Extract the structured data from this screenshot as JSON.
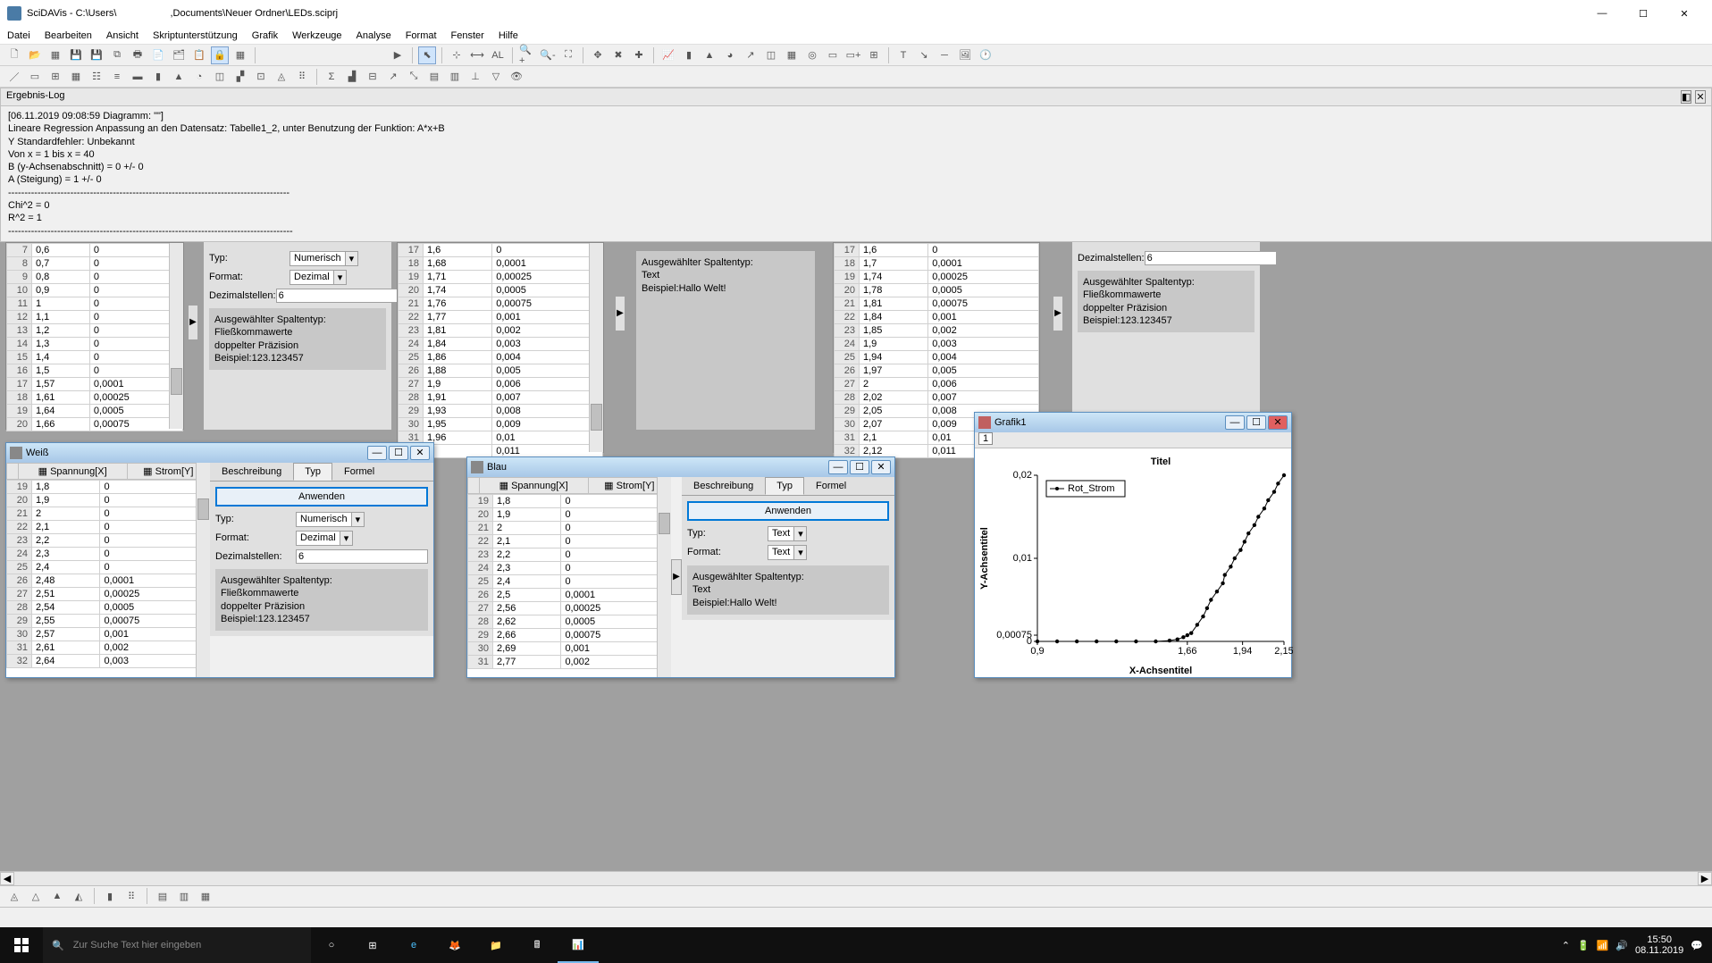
{
  "title_app": "SciDAVis - C:\\Users\\",
  "title_path": ",Documents\\Neuer Ordner\\LEDs.sciprj",
  "menu": [
    "Datei",
    "Bearbeiten",
    "Ansicht",
    "Skriptunterstützung",
    "Grafik",
    "Werkzeuge",
    "Analyse",
    "Format",
    "Fenster",
    "Hilfe"
  ],
  "log": {
    "title": "Ergebnis-Log",
    "lines": [
      "[06.11.2019 09:08:59        Diagramm: \"\"]",
      "Lineare Regression Anpassung an den Datensatz: Tabelle1_2, unter Benutzung der Funktion: A*x+B",
      "Y Standardfehler: Unbekannt",
      "Von x = 1 bis x = 40",
      "B (y-Achsenabschnitt) = 0 +/- 0",
      "A (Steigung) = 1 +/- 0",
      "--------------------------------------------------------------------------------------",
      "Chi^2 = 0",
      "R^2 = 1",
      "---------------------------------------------------------------------------------------"
    ]
  },
  "panel1": {
    "typ_label": "Typ:",
    "typ_val": "Numerisch",
    "format_label": "Format:",
    "format_val": "Dezimal",
    "dec_label": "Dezimalstellen:",
    "dec_val": "6",
    "info_title": "Ausgewählter Spaltentyp:",
    "info_l1": "Fließkommawerte",
    "info_l2": "doppelter Präzision",
    "info_l3": "Beispiel:123.123457"
  },
  "panel_text": {
    "info_title": "Ausgewählter Spaltentyp:",
    "info_l1": "Text",
    "info_l2": "Beispiel:Hallo Welt!"
  },
  "table_bg1": {
    "rows": [
      [
        7,
        "0,6",
        "0"
      ],
      [
        8,
        "0,7",
        "0"
      ],
      [
        9,
        "0,8",
        "0"
      ],
      [
        10,
        "0,9",
        "0"
      ],
      [
        11,
        "1",
        "0"
      ],
      [
        12,
        "1,1",
        "0"
      ],
      [
        13,
        "1,2",
        "0"
      ],
      [
        14,
        "1,3",
        "0"
      ],
      [
        15,
        "1,4",
        "0"
      ],
      [
        16,
        "1,5",
        "0"
      ],
      [
        17,
        "1,57",
        "0,0001"
      ],
      [
        18,
        "1,61",
        "0,00025"
      ],
      [
        19,
        "1,64",
        "0,0005"
      ],
      [
        20,
        "1,66",
        "0,00075"
      ]
    ]
  },
  "table_bg2": {
    "rows": [
      [
        17,
        "1,6",
        "0"
      ],
      [
        18,
        "1,68",
        "0,0001"
      ],
      [
        19,
        "1,71",
        "0,00025"
      ],
      [
        20,
        "1,74",
        "0,0005"
      ],
      [
        21,
        "1,76",
        "0,00075"
      ],
      [
        22,
        "1,77",
        "0,001"
      ],
      [
        23,
        "1,81",
        "0,002"
      ],
      [
        24,
        "1,84",
        "0,003"
      ],
      [
        25,
        "1,86",
        "0,004"
      ],
      [
        26,
        "1,88",
        "0,005"
      ],
      [
        27,
        "1,9",
        "0,006"
      ],
      [
        28,
        "1,91",
        "0,007"
      ],
      [
        29,
        "1,93",
        "0,008"
      ],
      [
        30,
        "1,95",
        "0,009"
      ],
      [
        31,
        "1,96",
        "0,01"
      ],
      [
        32,
        "",
        "0,011"
      ]
    ]
  },
  "table_bg3": {
    "rows": [
      [
        17,
        "1,6",
        "0"
      ],
      [
        18,
        "1,7",
        "0,0001"
      ],
      [
        19,
        "1,74",
        "0,00025"
      ],
      [
        20,
        "1,78",
        "0,0005"
      ],
      [
        21,
        "1,81",
        "0,00075"
      ],
      [
        22,
        "1,84",
        "0,001"
      ],
      [
        23,
        "1,85",
        "0,002"
      ],
      [
        24,
        "1,9",
        "0,003"
      ],
      [
        25,
        "1,94",
        "0,004"
      ],
      [
        26,
        "1,97",
        "0,005"
      ],
      [
        27,
        "2",
        "0,006"
      ],
      [
        28,
        "2,02",
        "0,007"
      ],
      [
        29,
        "2,05",
        "0,008"
      ],
      [
        30,
        "2,07",
        "0,009"
      ],
      [
        31,
        "2,1",
        "0,01"
      ],
      [
        32,
        "2,12",
        "0,011"
      ]
    ]
  },
  "panel_bg3": {
    "dec_label": "Dezimalstellen:",
    "dec_val": "6"
  },
  "weiss": {
    "title": "Weiß",
    "col1": "Spannung[X]",
    "col2": "Strom[Y]",
    "rows": [
      [
        19,
        "1,8",
        "0"
      ],
      [
        20,
        "1,9",
        "0"
      ],
      [
        21,
        "2",
        "0"
      ],
      [
        22,
        "2,1",
        "0"
      ],
      [
        23,
        "2,2",
        "0"
      ],
      [
        24,
        "2,3",
        "0"
      ],
      [
        25,
        "2,4",
        "0"
      ],
      [
        26,
        "2,48",
        "0,0001"
      ],
      [
        27,
        "2,51",
        "0,00025"
      ],
      [
        28,
        "2,54",
        "0,0005"
      ],
      [
        29,
        "2,55",
        "0,00075"
      ],
      [
        30,
        "2,57",
        "0,001"
      ],
      [
        31,
        "2,61",
        "0,002"
      ],
      [
        32,
        "2,64",
        "0,003"
      ]
    ],
    "tabs": [
      "Beschreibung",
      "Typ",
      "Formel"
    ],
    "apply": "Anwenden"
  },
  "blau": {
    "title": "Blau",
    "col1": "Spannung[X]",
    "col2": "Strom[Y]",
    "rows": [
      [
        19,
        "1,8",
        "0"
      ],
      [
        20,
        "1,9",
        "0"
      ],
      [
        21,
        "2",
        "0"
      ],
      [
        22,
        "2,1",
        "0"
      ],
      [
        23,
        "2,2",
        "0"
      ],
      [
        24,
        "2,3",
        "0"
      ],
      [
        25,
        "2,4",
        "0"
      ],
      [
        26,
        "2,5",
        "0,0001"
      ],
      [
        27,
        "2,56",
        "0,00025"
      ],
      [
        28,
        "2,62",
        "0,0005"
      ],
      [
        29,
        "2,66",
        "0,00075"
      ],
      [
        30,
        "2,69",
        "0,001"
      ],
      [
        31,
        "2,77",
        "0,002"
      ]
    ],
    "tabs": [
      "Beschreibung",
      "Typ",
      "Formel"
    ],
    "apply": "Anwenden",
    "typ_label": "Typ:",
    "typ_val": "Text",
    "format_label": "Format:",
    "format_val": "Text"
  },
  "grafik": {
    "title": "Grafik1",
    "tab": "1"
  },
  "chart_data": {
    "type": "scatter",
    "title": "Titel",
    "xlabel": "X-Achsentitel",
    "ylabel": "Y-Achsentitel",
    "legend": "Rot_Strom",
    "x_ticks": [
      "0,9",
      "1,66",
      "1,94",
      "2,15"
    ],
    "y_ticks": [
      "0",
      "0,00075",
      "0,01",
      "0,02"
    ],
    "series": [
      {
        "name": "Rot_Strom",
        "points": [
          [
            0.9,
            0
          ],
          [
            1.0,
            0
          ],
          [
            1.1,
            0
          ],
          [
            1.2,
            0
          ],
          [
            1.3,
            0
          ],
          [
            1.4,
            0
          ],
          [
            1.5,
            0
          ],
          [
            1.57,
            0.0001
          ],
          [
            1.61,
            0.00025
          ],
          [
            1.64,
            0.0005
          ],
          [
            1.66,
            0.00075
          ],
          [
            1.68,
            0.001
          ],
          [
            1.71,
            0.002
          ],
          [
            1.74,
            0.003
          ],
          [
            1.76,
            0.004
          ],
          [
            1.78,
            0.005
          ],
          [
            1.81,
            0.006
          ],
          [
            1.84,
            0.007
          ],
          [
            1.85,
            0.008
          ],
          [
            1.88,
            0.009
          ],
          [
            1.9,
            0.01
          ],
          [
            1.93,
            0.011
          ],
          [
            1.95,
            0.012
          ],
          [
            1.97,
            0.013
          ],
          [
            2.0,
            0.014
          ],
          [
            2.02,
            0.015
          ],
          [
            2.05,
            0.016
          ],
          [
            2.07,
            0.017
          ],
          [
            2.1,
            0.018
          ],
          [
            2.12,
            0.019
          ],
          [
            2.15,
            0.02
          ]
        ]
      }
    ]
  },
  "taskbar": {
    "search": "Zur Suche Text hier eingeben",
    "time": "15:50",
    "date": "08.11.2019"
  }
}
